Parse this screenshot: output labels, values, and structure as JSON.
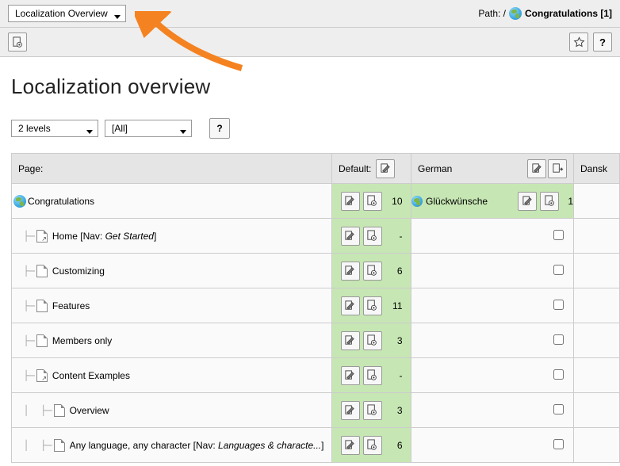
{
  "topbar": {
    "module_select": "Localization Overview",
    "path_prefix": "Path: /",
    "path_title": "Congratulations [1]"
  },
  "page_title": "Localization overview",
  "controls": {
    "depth": "2 levels",
    "language_filter": "[All]",
    "help_label": "?"
  },
  "columns": {
    "page": "Page:",
    "default": "Default:",
    "german": "German",
    "dansk": "Dansk"
  },
  "rows": [
    {
      "indent": 0,
      "icon": "globe",
      "title": "Congratulations",
      "suffix": "",
      "default_count": "10",
      "german": {
        "title": "Glückwünsche",
        "count": "1"
      }
    },
    {
      "indent": 1,
      "icon": "shortcut",
      "title": "Home",
      "suffix": "[Nav: Get Started]",
      "default_count": "-",
      "german": null
    },
    {
      "indent": 1,
      "icon": "page",
      "title": "Customizing",
      "suffix": "",
      "default_count": "6",
      "german": null
    },
    {
      "indent": 1,
      "icon": "page",
      "title": "Features",
      "suffix": "",
      "default_count": "11",
      "german": null
    },
    {
      "indent": 1,
      "icon": "page",
      "title": "Members only",
      "suffix": "",
      "default_count": "3",
      "german": null
    },
    {
      "indent": 1,
      "icon": "shortcut",
      "title": "Content Examples",
      "suffix": "",
      "default_count": "-",
      "german": null
    },
    {
      "indent": 2,
      "icon": "page",
      "title": "Overview",
      "suffix": "",
      "default_count": "3",
      "german": null
    },
    {
      "indent": 2,
      "icon": "page",
      "title": "Any language, any character",
      "suffix": "[Nav: Languages & characte...]",
      "default_count": "6",
      "german": null
    }
  ]
}
